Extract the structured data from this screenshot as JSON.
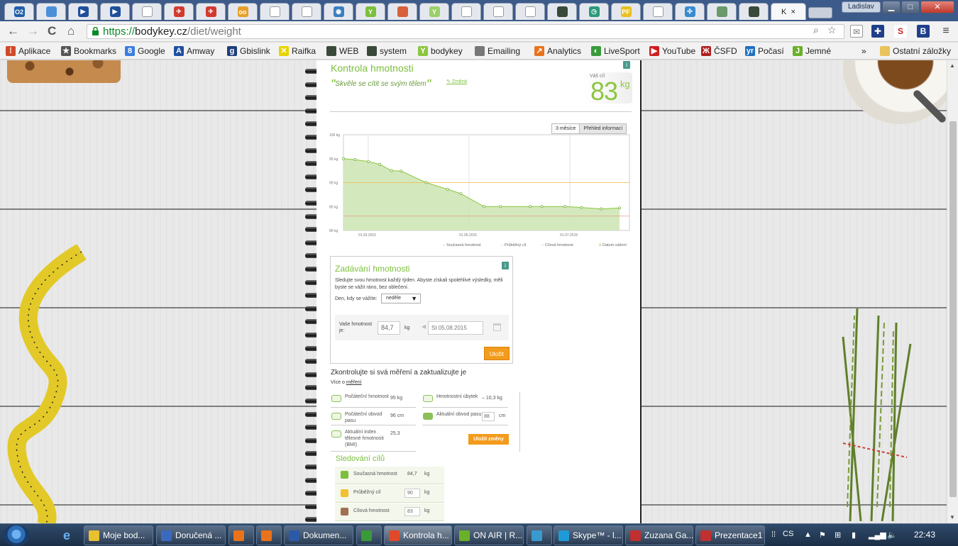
{
  "browser": {
    "tabs": [
      {
        "icon": "o2-icon",
        "label": "O2",
        "color": "#1f5ea8"
      },
      {
        "icon": "chat-icon",
        "label": "",
        "color": "#4a90d9"
      },
      {
        "icon": "play-icon",
        "label": "▶",
        "color": "#1e4f9a"
      },
      {
        "icon": "play-icon",
        "label": "▶",
        "color": "#1e4f9a"
      },
      {
        "icon": "page-icon",
        "label": "",
        "color": "#ffffff"
      },
      {
        "icon": "plane-icon",
        "label": "✈",
        "color": "#d23a2e"
      },
      {
        "icon": "plane-icon",
        "label": "✈",
        "color": "#d23a2e"
      },
      {
        "icon": "owl-icon",
        "label": "oo",
        "color": "#e6a02a"
      },
      {
        "icon": "page-icon",
        "label": "",
        "color": "#ffffff"
      },
      {
        "icon": "page-icon",
        "label": "",
        "color": "#ffffff"
      },
      {
        "icon": "camera-icon",
        "label": "◉",
        "color": "#3a7fbf"
      },
      {
        "icon": "bodykey-icon",
        "label": "Y",
        "color": "#7cbf3b"
      },
      {
        "icon": "flag-icon",
        "label": "",
        "color": "#d8603c"
      },
      {
        "icon": "bodykey-icon",
        "label": "Y",
        "color": "#9bd06a"
      },
      {
        "icon": "page-icon",
        "label": "",
        "color": "#ffffff"
      },
      {
        "icon": "page-icon",
        "label": "",
        "color": "#ffffff"
      },
      {
        "icon": "page-icon",
        "label": "",
        "color": "#ffffff"
      },
      {
        "icon": "profile-icon",
        "label": "",
        "color": "#3a4a3a"
      },
      {
        "icon": "clock-icon",
        "label": "◷",
        "color": "#2a9a7a"
      },
      {
        "icon": "pf-icon",
        "label": "PF",
        "color": "#e8c020"
      },
      {
        "icon": "page-icon",
        "label": "",
        "color": "#ffffff"
      },
      {
        "icon": "puzzle-icon",
        "label": "✣",
        "color": "#3a8ad0"
      },
      {
        "icon": "photo-icon",
        "label": "",
        "color": "#6a9a6a"
      },
      {
        "icon": "profile-icon",
        "label": "",
        "color": "#3a4a3a"
      }
    ],
    "active_tab_label": "K",
    "active_tab_close": "×",
    "user": "Ladislav",
    "win_min": "▁",
    "win_max": "□",
    "win_close": "✕",
    "nav": {
      "back": "←",
      "forward": "→",
      "reload": "C",
      "home": "⌂"
    },
    "url": {
      "scheme": "https://",
      "host": "bodykey.cz",
      "path": "/diet/weight"
    },
    "bookmarks": [
      {
        "label": "Aplikace",
        "icon": "apps-icon",
        "color": "#d04a2a",
        "glyph": "⁞"
      },
      {
        "label": "Bookmarks",
        "icon": "star-icon",
        "color": "#555555",
        "glyph": "★"
      },
      {
        "label": "Google",
        "icon": "google-icon",
        "color": "#3b7de0",
        "glyph": "8"
      },
      {
        "label": "Amway",
        "icon": "amway-icon",
        "color": "#1f4fa0",
        "glyph": "A"
      },
      {
        "label": "Gbislink",
        "icon": "gbislink-icon",
        "color": "#1f3f7a",
        "glyph": "g"
      },
      {
        "label": "Raifka",
        "icon": "raifka-icon",
        "color": "#e8d400",
        "glyph": "✕"
      },
      {
        "label": "WEB",
        "icon": "profile-icon",
        "color": "#3a4a3a",
        "glyph": ""
      },
      {
        "label": "system",
        "icon": "profile-icon",
        "color": "#3a4a3a",
        "glyph": ""
      },
      {
        "label": "bodykey",
        "icon": "bodykey-icon",
        "color": "#8cc63f",
        "glyph": "Y"
      },
      {
        "label": "Emailing",
        "icon": "frame-icon",
        "color": "#777777",
        "glyph": ""
      },
      {
        "label": "Analytics",
        "icon": "analytics-icon",
        "color": "#e8731c",
        "glyph": "↗"
      },
      {
        "label": "LiveSport",
        "icon": "livesport-icon",
        "color": "#3a9a3a",
        "glyph": "◐"
      },
      {
        "label": "YouTube",
        "icon": "youtube-icon",
        "color": "#d01f1f",
        "glyph": "▶"
      },
      {
        "label": "ČSFD",
        "icon": "csfd-icon",
        "color": "#b01f1f",
        "glyph": "Ж"
      },
      {
        "label": "Počasí",
        "icon": "yr-icon",
        "color": "#1f6fc0",
        "glyph": "yr"
      },
      {
        "label": "Jemné",
        "icon": "jemne-icon",
        "color": "#6ab02a",
        "glyph": "J"
      }
    ],
    "bookmarks_overflow": "»",
    "other_bookmarks": "Ostatní záložky"
  },
  "page": {
    "header": {
      "title": "Kontrola hmotnosti",
      "motto": "Skvěle se cítit se svým tělem",
      "quote_open": "\"",
      "quote_close": "\"",
      "change_link": "Změnit",
      "goal_label": "Váš cíl",
      "goal_value": "83",
      "goal_unit": "kg",
      "info": "i"
    },
    "chart_tabs": [
      "3 měsíce",
      "Přehled informací"
    ],
    "legend": [
      "Současná hmotnost",
      "Průběžný cíl",
      "Cílová hmotnost",
      "Datum vážení"
    ],
    "entry": {
      "title": "Zadávání hmotnosti",
      "info": "i",
      "description": "Sledujte svou hmotnost každý týden. Abyste získali spolehlivé výsledky, měli byste se vážit ráno, bez oblečení.",
      "day_label": "Den, kdy se vážíte:",
      "day_value": "neděle",
      "day_caret": "▼",
      "weight_label": "Vaše hmotnost je:",
      "weight_value": "84,7",
      "weight_unit": "kg",
      "date_arrow": "◀",
      "date_value": "St 05.08.2015",
      "save": "Uložit"
    },
    "measurements": {
      "title": "Zkontrolujte si svá měření a zaktualizujte je",
      "more_prefix": "Více o",
      "more_link": "měření",
      "items": [
        {
          "label": "Počáteční hmotnost",
          "value": "95 kg"
        },
        {
          "label": "Hmotnostní úbytek",
          "value": "– 10,3 kg"
        },
        {
          "label": "Počáteční obvod pasu",
          "value": "96 cm"
        },
        {
          "label": "Aktuální obvod pasu",
          "value": "88",
          "unit": "cm"
        },
        {
          "label": "Aktuální index tělesné hmotnosti (BMI)",
          "value": "25,3"
        }
      ],
      "save": "Uložit změny"
    },
    "goals": {
      "title": "Sledování cílů",
      "rows": [
        {
          "label": "Současná hmotnost",
          "value": "84,7",
          "unit": "kg",
          "color": "#7cbf3b"
        },
        {
          "label": "Průběžný cíl",
          "value": "90",
          "unit": "kg",
          "color": "#f2c12e"
        },
        {
          "label": "Cílová hmotnost",
          "value": "83",
          "unit": "kg",
          "color": "#a07050"
        }
      ]
    }
  },
  "chart_data": {
    "type": "line",
    "y_tick_labels": [
      "100 kg",
      "95 kg",
      "90 kg",
      "85 kg",
      "80 kg"
    ],
    "ylim": [
      80,
      100
    ],
    "x_tick_labels": [
      "01.03.2015",
      "01.05.2015",
      "01.07.2015"
    ],
    "series": [
      {
        "name": "Současná hmotnost",
        "color": "#8cc63f",
        "x": [
          "2015-02-14",
          "2015-02-21",
          "2015-03-01",
          "2015-03-08",
          "2015-03-15",
          "2015-03-21",
          "2015-04-05",
          "2015-04-18",
          "2015-04-26",
          "2015-05-10",
          "2015-05-20",
          "2015-06-07",
          "2015-06-14",
          "2015-06-28",
          "2015-07-08",
          "2015-07-20",
          "2015-07-31"
        ],
        "y": [
          95,
          94.8,
          94.4,
          93.8,
          92.5,
          92.4,
          90,
          88.6,
          87.7,
          85,
          85,
          85,
          85,
          85,
          84.8,
          84.5,
          84.7
        ]
      },
      {
        "name": "Průběžný cíl",
        "color": "#f2b84b",
        "y": 90
      },
      {
        "name": "Cílová hmotnost",
        "color": "#e0a080",
        "y": 83
      }
    ],
    "grid": true,
    "legend_position": "bottom-right"
  },
  "taskbar": {
    "items": [
      {
        "label": "Moje bod...",
        "color": "#e8c030"
      },
      {
        "label": "Doručená ...",
        "color": "#3a6ac0"
      },
      {
        "label": "",
        "color": "#e8731c"
      },
      {
        "label": "",
        "color": "#e8731c"
      },
      {
        "label": "Dokumen...",
        "color": "#2b5aa8"
      },
      {
        "label": "",
        "color": "#3a9a3a"
      },
      {
        "label": "Kontrola h...",
        "color": "#e04a2a"
      },
      {
        "label": "ON AIR | R...",
        "color": "#6ab02a"
      },
      {
        "label": "",
        "color": "#3a9ad0"
      },
      {
        "label": "Skype™ - l...",
        "color": "#1f9ad8"
      },
      {
        "label": "Zuzana Ga...",
        "color": "#c03030"
      },
      {
        "label": "Prezentace1",
        "color": "#c03030"
      }
    ],
    "language": "CS",
    "clock": "22:43"
  }
}
